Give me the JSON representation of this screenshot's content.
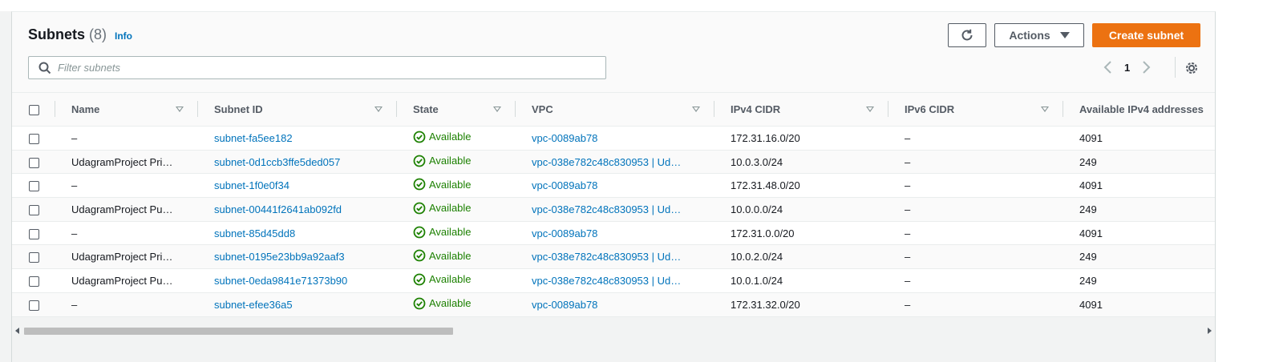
{
  "header": {
    "title": "Subnets",
    "count": "(8)",
    "info": "Info",
    "actions_label": "Actions",
    "create_label": "Create subnet"
  },
  "filter": {
    "placeholder": "Filter subnets"
  },
  "pagination": {
    "current_page": "1"
  },
  "columns": [
    "Name",
    "Subnet ID",
    "State",
    "VPC",
    "IPv4 CIDR",
    "IPv6 CIDR",
    "Available IPv4 addresses"
  ],
  "rows": [
    {
      "name": "–",
      "subnet_id": "subnet-fa5ee182",
      "state": "Available",
      "vpc": "vpc-0089ab78",
      "ipv4": "172.31.16.0/20",
      "ipv6": "–",
      "available": "4091"
    },
    {
      "name": "UdagramProject Pri…",
      "subnet_id": "subnet-0d1ccb3ffe5ded057",
      "state": "Available",
      "vpc": "vpc-038e782c48c830953 | Ud…",
      "ipv4": "10.0.3.0/24",
      "ipv6": "–",
      "available": "249"
    },
    {
      "name": "–",
      "subnet_id": "subnet-1f0e0f34",
      "state": "Available",
      "vpc": "vpc-0089ab78",
      "ipv4": "172.31.48.0/20",
      "ipv6": "–",
      "available": "4091"
    },
    {
      "name": "UdagramProject Pu…",
      "subnet_id": "subnet-00441f2641ab092fd",
      "state": "Available",
      "vpc": "vpc-038e782c48c830953 | Ud…",
      "ipv4": "10.0.0.0/24",
      "ipv6": "–",
      "available": "249"
    },
    {
      "name": "–",
      "subnet_id": "subnet-85d45dd8",
      "state": "Available",
      "vpc": "vpc-0089ab78",
      "ipv4": "172.31.0.0/20",
      "ipv6": "–",
      "available": "4091"
    },
    {
      "name": "UdagramProject Pri…",
      "subnet_id": "subnet-0195e23bb9a92aaf3",
      "state": "Available",
      "vpc": "vpc-038e782c48c830953 | Ud…",
      "ipv4": "10.0.2.0/24",
      "ipv6": "–",
      "available": "249"
    },
    {
      "name": "UdagramProject Pu…",
      "subnet_id": "subnet-0eda9841e71373b90",
      "state": "Available",
      "vpc": "vpc-038e782c48c830953 | Ud…",
      "ipv4": "10.0.1.0/24",
      "ipv6": "–",
      "available": "249"
    },
    {
      "name": "–",
      "subnet_id": "subnet-efee36a5",
      "state": "Available",
      "vpc": "vpc-0089ab78",
      "ipv4": "172.31.32.0/20",
      "ipv6": "–",
      "available": "4091"
    }
  ],
  "icons": {
    "refresh": "refresh-icon",
    "actions_caret": "caret-down-icon",
    "search": "search-icon",
    "prev": "chevron-left-icon",
    "next": "chevron-right-icon",
    "settings": "gear-icon",
    "status_ok": "check-circle-icon",
    "sort": "sort-caret-icon"
  },
  "colors": {
    "primary_button": "#ec7211",
    "link": "#0073bb",
    "status_success": "#1d8102",
    "background": "#f2f3f3"
  }
}
